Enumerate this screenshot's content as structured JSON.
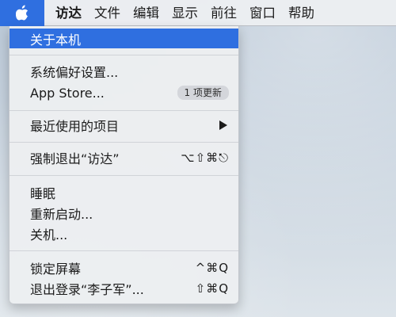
{
  "menubar": {
    "apple_icon": "apple-logo-icon",
    "items": [
      {
        "label": "访达"
      },
      {
        "label": "文件"
      },
      {
        "label": "编辑"
      },
      {
        "label": "显示"
      },
      {
        "label": "前往"
      },
      {
        "label": "窗口"
      },
      {
        "label": "帮助"
      }
    ]
  },
  "apple_menu": {
    "items": [
      {
        "label": "关于本机",
        "highlighted": true
      },
      {
        "label": "系统偏好设置..."
      },
      {
        "label": "App Store...",
        "badge": "1 项更新"
      },
      {
        "label": "最近使用的项目",
        "submenu_icon": "triangle-right-icon"
      },
      {
        "label": "强制退出“访达”",
        "shortcut": "⌥⇧⌘⎋"
      },
      {
        "label": "睡眠"
      },
      {
        "label": "重新启动..."
      },
      {
        "label": "关机..."
      },
      {
        "label": "锁定屏幕",
        "shortcut": "^⌘Q"
      },
      {
        "label": "退出登录“李子军”...",
        "shortcut": "⇧⌘Q"
      }
    ]
  },
  "colors": {
    "highlight": "#2f6fe0",
    "menu_bg": "#eceef1",
    "text": "#1b1b1b"
  }
}
